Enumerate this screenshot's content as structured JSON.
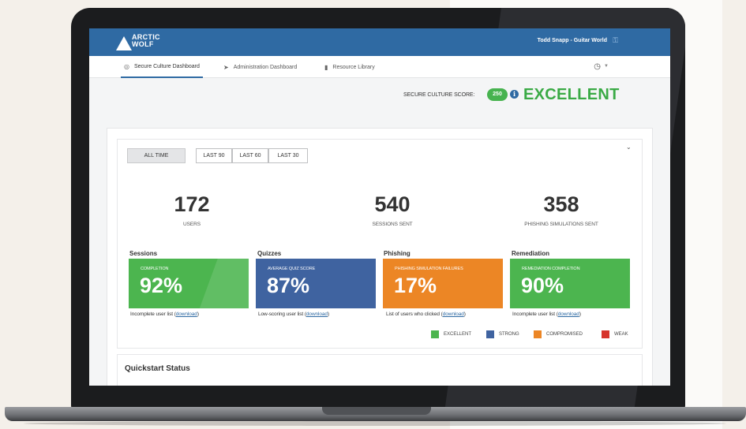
{
  "header": {
    "logo_line1": "ARCTIC",
    "logo_line2": "WOLF",
    "user": "Todd Snapp - Guitar World"
  },
  "nav": {
    "tabs": [
      {
        "label": "Secure Culture Dashboard",
        "icon": "globe-icon",
        "active": true
      },
      {
        "label": "Administration Dashboard",
        "icon": "rocket-icon",
        "active": false
      },
      {
        "label": "Resource Library",
        "icon": "folder-icon",
        "active": false
      }
    ]
  },
  "score": {
    "label": "SECURE CULTURE SCORE:",
    "value": "250",
    "rating": "EXCELLENT"
  },
  "filters": [
    "ALL TIME",
    "LAST 90",
    "LAST 60",
    "LAST 30"
  ],
  "stats": [
    {
      "value": "172",
      "label": "USERS"
    },
    {
      "value": "540",
      "label": "SESSIONS SENT"
    },
    {
      "value": "358",
      "label": "PHISHING SIMULATIONS SENT"
    }
  ],
  "tiles": [
    {
      "title": "Sessions",
      "caption": "COMPLETION",
      "percent": "92%",
      "link_text": "Incomplete user list (",
      "link_label": "download",
      "link_end": ")",
      "color": "#4cb54f"
    },
    {
      "title": "Quizzes",
      "caption": "AVERAGE QUIZ SCORE",
      "percent": "87%",
      "link_text": "Low-scoring user list (",
      "link_label": "download",
      "link_end": ")",
      "color": "#3f63a0"
    },
    {
      "title": "Phishing",
      "caption": "PHISHING SIMULATION FAILURES",
      "percent": "17%",
      "link_text": "List of users who clicked (",
      "link_label": "download",
      "link_end": ")",
      "color": "#ec8625"
    },
    {
      "title": "Remediation",
      "caption": "REMEDIATION COMPLETION",
      "percent": "90%",
      "link_text": "Incomplete user list (",
      "link_label": "download",
      "link_end": ")",
      "color": "#4cb54f"
    }
  ],
  "legend": [
    {
      "label": "EXCELLENT",
      "color": "#4cb54f"
    },
    {
      "label": "STRONG",
      "color": "#3f63a0"
    },
    {
      "label": "COMPROMISED",
      "color": "#ec8625"
    },
    {
      "label": "WEAK",
      "color": "#d6332b"
    }
  ],
  "quickstart": {
    "title": "Quickstart Status"
  }
}
